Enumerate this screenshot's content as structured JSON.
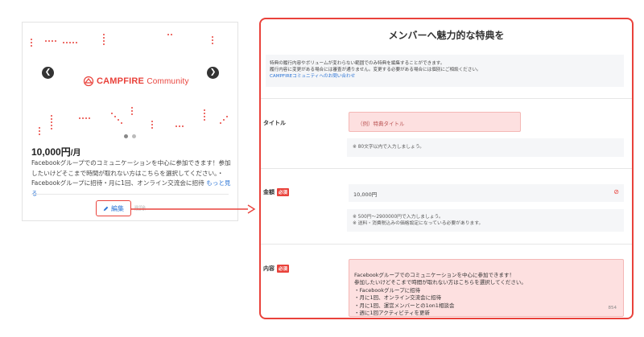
{
  "card": {
    "logo_brand": "CAMPFIRE",
    "logo_sub": "Community",
    "price": "10,000円",
    "price_unit": "/月",
    "description": "Facebookグループでのコミュニケーションを中心に参加できます！参加したいけどそこまで時間が取れない方はこちらを選択してください。・Facebookグループに招待・月に1回、オンライン交流会に招待",
    "more_label": "もっと見る",
    "edit_label": "編集",
    "delete_label": "削除",
    "prev_icon": "chevron-left-icon",
    "next_icon": "chevron-right-icon"
  },
  "form": {
    "title": "メンバーへ魅力的な特典を",
    "notice_line1": "特典の履行内容やボリュームが変わらない範囲でのみ特典を編集することができます。",
    "notice_line2": "履行内容に変更がある場合には審査が通りません。変更する必要がある場合には個別にご相談ください。",
    "notice_link": "CAMPFIREコミュニティへのお問い合わせ",
    "title_label": "タイトル",
    "title_placeholder": "（例）特典タイトル",
    "title_hint": "※ 80文字以内で入力しましょう。",
    "amount_label": "金額",
    "required_badge": "必須",
    "amount_value": "10,000円",
    "amount_hint1": "※ 500円〜2900000円で入力しましょう。",
    "amount_hint2": "※ 送料・消費税込みの価格設定になっている必要があります。",
    "content_label": "内容",
    "content_value": "Facebookグループでのコミュニケーションを中心に参加できます！\n参加したいけどそこまで時間が取れない方はこちらを選択してください。\n・Facebookグループに招待\n・月に1回、オンライン交流会に招待\n・月に1回、運営メンバーとの1on1相談会\n・週に1回アクティビティを更新",
    "char_count": "854"
  },
  "colors": {
    "accent": "#e9423b",
    "link": "#2b74d6",
    "error_fill": "#fde0e0"
  }
}
